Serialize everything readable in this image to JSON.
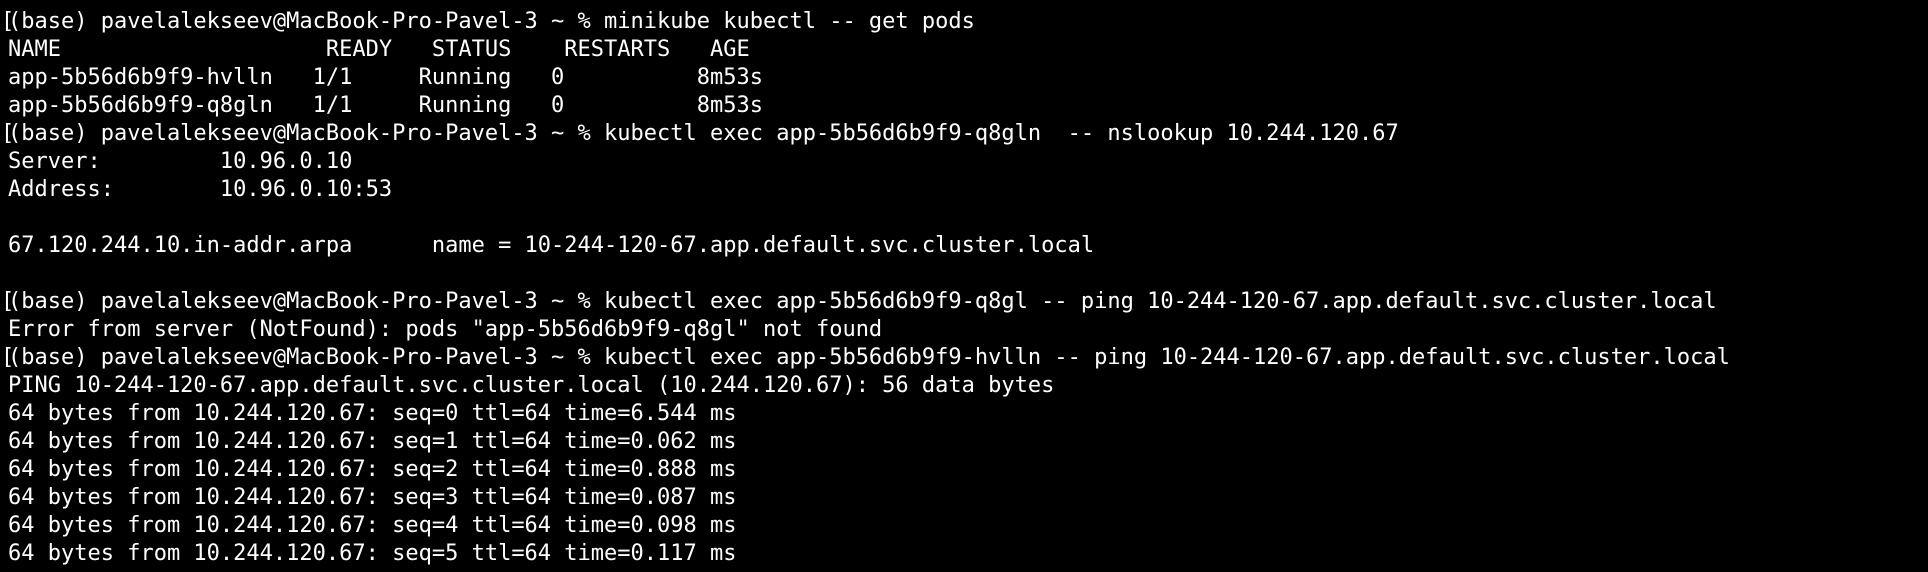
{
  "terminal": {
    "lines": [
      "(base) pavelalekseev@MacBook-Pro-Pavel-3 ~ % minikube kubectl -- get pods",
      "NAME                    READY   STATUS    RESTARTS   AGE",
      "app-5b56d6b9f9-hvlln   1/1     Running   0          8m53s",
      "app-5b56d6b9f9-q8gln   1/1     Running   0          8m53s",
      "(base) pavelalekseev@MacBook-Pro-Pavel-3 ~ % kubectl exec app-5b56d6b9f9-q8gln  -- nslookup 10.244.120.67",
      "Server:         10.96.0.10",
      "Address:        10.96.0.10:53",
      "",
      "67.120.244.10.in-addr.arpa      name = 10-244-120-67.app.default.svc.cluster.local",
      "",
      "(base) pavelalekseev@MacBook-Pro-Pavel-3 ~ % kubectl exec app-5b56d6b9f9-q8gl -- ping 10-244-120-67.app.default.svc.cluster.local",
      "Error from server (NotFound): pods \"app-5b56d6b9f9-q8gl\" not found",
      "(base) pavelalekseev@MacBook-Pro-Pavel-3 ~ % kubectl exec app-5b56d6b9f9-hvlln -- ping 10-244-120-67.app.default.svc.cluster.local",
      "PING 10-244-120-67.app.default.svc.cluster.local (10.244.120.67): 56 data bytes",
      "64 bytes from 10.244.120.67: seq=0 ttl=64 time=6.544 ms",
      "64 bytes from 10.244.120.67: seq=1 ttl=64 time=0.062 ms",
      "64 bytes from 10.244.120.67: seq=2 ttl=64 time=0.888 ms",
      "64 bytes from 10.244.120.67: seq=3 ttl=64 time=0.087 ms",
      "64 bytes from 10.244.120.67: seq=4 ttl=64 time=0.098 ms",
      "64 bytes from 10.244.120.67: seq=5 ttl=64 time=0.117 ms"
    ],
    "prompt_marker": "["
  }
}
